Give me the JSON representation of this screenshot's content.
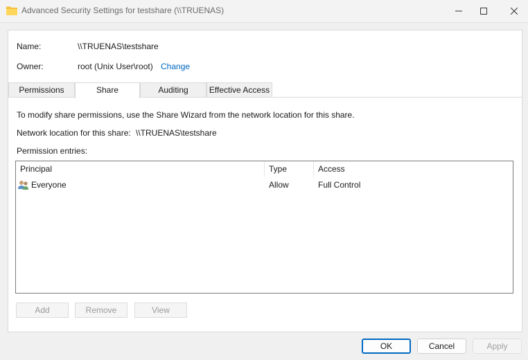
{
  "window": {
    "title": "Advanced Security Settings for testshare (\\\\TRUENAS)"
  },
  "header": {
    "name_label": "Name:",
    "name_value": "\\\\TRUENAS\\testshare",
    "owner_label": "Owner:",
    "owner_value": "root (Unix User\\root)",
    "change_link": "Change"
  },
  "tabs": [
    {
      "label": "Permissions",
      "active": false
    },
    {
      "label": "Share",
      "active": true
    },
    {
      "label": "Auditing",
      "active": false
    },
    {
      "label": "Effective Access",
      "active": false
    }
  ],
  "share": {
    "info_text": "To modify share permissions, use the Share Wizard from the network location for this share.",
    "network_label": "Network location for this share:",
    "network_value": "\\\\TRUENAS\\testshare",
    "entries_label": "Permission entries:",
    "columns": [
      "Principal",
      "Type",
      "Access"
    ],
    "rows": [
      {
        "principal": "Everyone",
        "type": "Allow",
        "access": "Full Control",
        "icon": "users-icon"
      }
    ],
    "buttons": {
      "add": "Add",
      "remove": "Remove",
      "view": "View"
    }
  },
  "footer": {
    "ok": "OK",
    "cancel": "Cancel",
    "apply": "Apply"
  },
  "colors": {
    "link": "#0067c0",
    "accent": "#0067c0"
  }
}
